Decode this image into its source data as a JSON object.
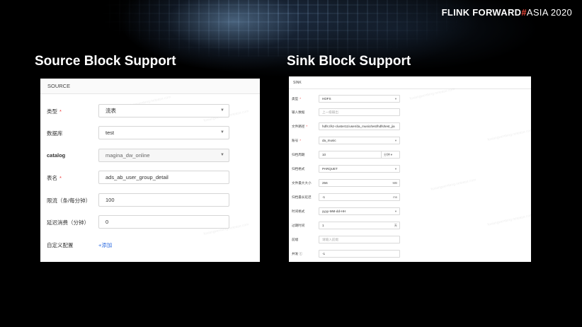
{
  "brand": {
    "part1": "FLINK FORWARD",
    "hash": "#",
    "part2": "ASIA 2020"
  },
  "titles": {
    "source": "Source Block Support",
    "sink": "Sink Block Support"
  },
  "source": {
    "header": "SOURCE",
    "rows": [
      {
        "label": "类型",
        "required": "*",
        "value": "流表",
        "type": "select"
      },
      {
        "label": "数据库",
        "value": "test",
        "type": "select"
      },
      {
        "label": "catalog",
        "value": "magina_dw_online",
        "type": "select-disabled"
      },
      {
        "label": "表名",
        "required": "*",
        "value": "ads_ab_user_group_detail",
        "type": "input"
      },
      {
        "label": "限流（条/每分钟）",
        "value": "100",
        "type": "input"
      },
      {
        "label": "延迟消费（分钟）",
        "value": "0",
        "type": "input"
      }
    ],
    "custom_config_label": "自定义配置",
    "add_label": "+添加"
  },
  "sink": {
    "header": "SINK",
    "rows": [
      {
        "label": "类型",
        "required": "*",
        "value": "HDFS",
        "type": "select"
      },
      {
        "label": "输入数据",
        "value": "上一级输出",
        "type": "placeholder"
      },
      {
        "label": "文件路径",
        "required": "*",
        "value": "hdfs://kz-cluster11/user/da_music/test/hdfs/test_jia",
        "type": "input"
      },
      {
        "label": "账号",
        "required": "*",
        "value": "da_music",
        "type": "select"
      },
      {
        "label": "归档周期",
        "value": "10",
        "unit": "分钟",
        "type": "unit-select"
      },
      {
        "label": "归档格式",
        "value": "PARQUET",
        "type": "select"
      },
      {
        "label": "文件最大大小",
        "value": "256",
        "unit": "MB",
        "type": "unit"
      },
      {
        "label": "归档最长延迟",
        "value": "-1",
        "unit": "ms",
        "type": "unit"
      },
      {
        "label": "时间格式",
        "value": "yyyy-MM-dd-HH",
        "type": "select"
      },
      {
        "label": "过期时间",
        "value": "1",
        "unit": "天",
        "type": "unit"
      },
      {
        "label": "前缀",
        "value": "请输入前缀",
        "type": "placeholder"
      },
      {
        "label": "并发 ⓘ",
        "value": "-1",
        "type": "input"
      }
    ]
  },
  "colors": {
    "accent_red": "#e8473a",
    "link_blue": "#2f6de1",
    "required_red": "#e33333"
  }
}
